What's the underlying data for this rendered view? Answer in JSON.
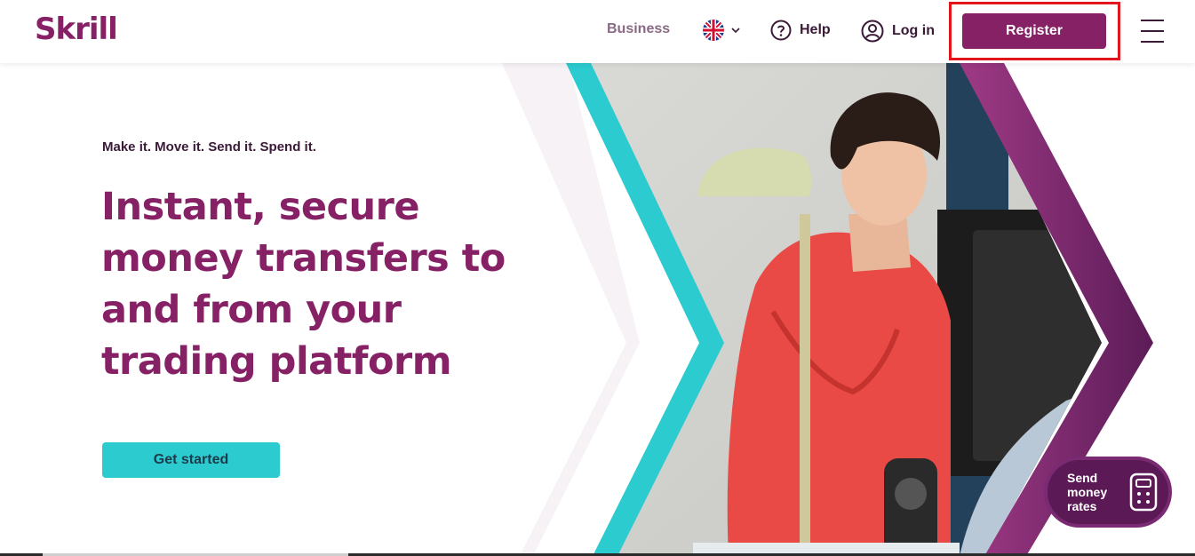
{
  "header": {
    "logo": "Skrill",
    "business_label": "Business",
    "language_icon": "uk-flag-icon",
    "help_label": "Help",
    "login_label": "Log in",
    "register_label": "Register",
    "menu_icon": "hamburger-menu-icon"
  },
  "hero": {
    "tagline": "Make it. Move it. Send it. Spend it.",
    "headline": "Instant, secure money transfers to and from your trading platform",
    "cta_label": "Get started"
  },
  "rates_widget": {
    "label_line1": "Send",
    "label_line2": "money",
    "label_line3": "rates",
    "icon": "calculator-icon"
  },
  "colors": {
    "brand_purple": "#862165",
    "accent_teal": "#2bcbd0",
    "highlight_red": "#e3151c"
  }
}
